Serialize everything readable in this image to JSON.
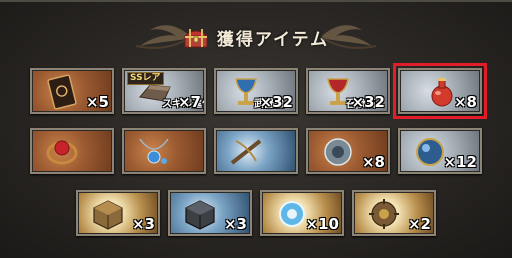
{
  "dialog": {
    "title": "獲得アイテム",
    "icons": {
      "title": "treasure-chest-icon"
    },
    "colors": {
      "highlight": "#e21d2a",
      "title": "#f3ead8"
    }
  },
  "items": [
    {
      "id": "book",
      "icon": "spellbook-icon",
      "quantity": "×5",
      "frame": "bronze"
    },
    {
      "id": "skill-stone",
      "icon": "ingot-icon",
      "tag": "SSレア",
      "caption": "スキル進化",
      "quantity": "×7",
      "frame": "silver"
    },
    {
      "id": "weapon-stone",
      "icon": "chalice-blue-icon",
      "caption": "武器強",
      "quantity": "×32",
      "frame": "silver"
    },
    {
      "id": "summon-stone",
      "icon": "chalice-red-icon",
      "caption": "召喚石",
      "quantity": "×32",
      "frame": "silver"
    },
    {
      "id": "potion",
      "icon": "red-potion-icon",
      "quantity": "×8",
      "frame": "silver",
      "selected": true
    },
    {
      "id": "red-ring",
      "icon": "red-gem-ring-icon",
      "quantity": "",
      "frame": "bronze"
    },
    {
      "id": "blue-pendant",
      "icon": "blue-pendant-icon",
      "quantity": "",
      "frame": "bronze"
    },
    {
      "id": "crossbow",
      "icon": "crossbow-icon",
      "quantity": "",
      "frame": "steel"
    },
    {
      "id": "emblem",
      "icon": "emblem-icon",
      "quantity": "×8",
      "frame": "bronze"
    },
    {
      "id": "blue-orb",
      "icon": "blue-orb-icon",
      "quantity": "×12",
      "frame": "silver"
    },
    {
      "id": "gold-cube",
      "icon": "gold-cube-icon",
      "quantity": "×3",
      "frame": "gold"
    },
    {
      "id": "dark-cube",
      "icon": "dark-cube-icon",
      "quantity": "×3",
      "frame": "steel"
    },
    {
      "id": "crystal-orb",
      "icon": "crystal-orb-icon",
      "quantity": "×10",
      "frame": "gold"
    },
    {
      "id": "gear",
      "icon": "gear-icon",
      "quantity": "×2",
      "frame": "gold"
    }
  ]
}
